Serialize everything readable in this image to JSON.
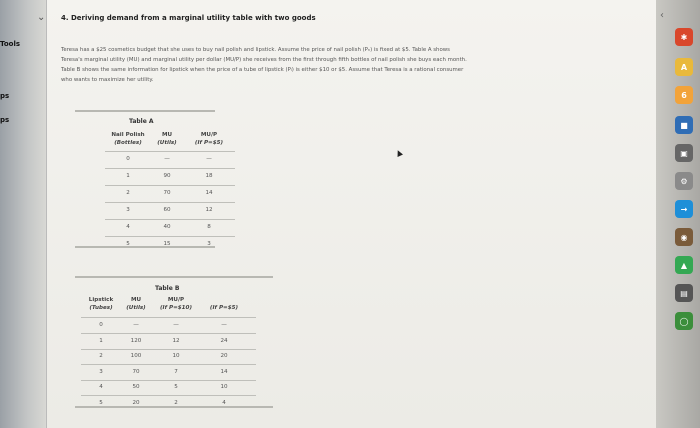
{
  "sidebar": {
    "tools_label": "Tools",
    "item1": "ps",
    "item2": "ps"
  },
  "question": {
    "title": "4. Deriving demand from a marginal utility table with two goods",
    "lines": [
      "Teresa has a $25 cosmetics budget that she uses to buy nail polish and lipstick. Assume the price of nail polish (Pₙ) is fixed at $5. Table A shows",
      "Teresa's marginal utility (MU) and marginal utility per dollar (MU/P) she receives from the first through fifth bottles of nail polish she buys each month.",
      "Table B shows the same information for lipstick when the price of a tube of lipstick (Pₗ) is either $10 or $5. Assume that Teresa is a rational consumer",
      "who wants to maximize her utility."
    ]
  },
  "table_a": {
    "title": "Table A",
    "col1_a": "Nail Polish",
    "col1_b": "(Bottles)",
    "col2_a": "MU",
    "col2_b": "(Utils)",
    "col3_a": "MU/P",
    "col3_b": "(If P=$5)",
    "rows": [
      [
        "0",
        "—",
        "—"
      ],
      [
        "1",
        "90",
        "18"
      ],
      [
        "2",
        "70",
        "14"
      ],
      [
        "3",
        "60",
        "12"
      ],
      [
        "4",
        "40",
        "8"
      ],
      [
        "5",
        "15",
        "3"
      ]
    ]
  },
  "table_b": {
    "title": "Table B",
    "col1_a": "Lipstick",
    "col1_b": "(Tubes)",
    "col2_a": "MU",
    "col2_b": "(Utils)",
    "col3_a": "MU/P",
    "col3_b": "(If P=$10)",
    "col4_b": "(If P=$5)",
    "rows": [
      [
        "0",
        "—",
        "—",
        "—"
      ],
      [
        "1",
        "120",
        "12",
        "24"
      ],
      [
        "2",
        "100",
        "10",
        "20"
      ],
      [
        "3",
        "70",
        "7",
        "14"
      ],
      [
        "4",
        "50",
        "5",
        "10"
      ],
      [
        "5",
        "20",
        "2",
        "4"
      ]
    ]
  },
  "dock": {
    "icons": [
      {
        "name": "app-icon-1",
        "color": "#d9472b",
        "glyph": "✱"
      },
      {
        "name": "app-icon-2",
        "color": "#e9b93b",
        "glyph": "A"
      },
      {
        "name": "app-icon-3",
        "color": "#f2a33a",
        "glyph": "6"
      },
      {
        "name": "app-icon-4",
        "color": "#2f6db5",
        "glyph": "■"
      },
      {
        "name": "app-icon-5",
        "color": "#666666",
        "glyph": "▣"
      },
      {
        "name": "app-icon-6",
        "color": "#8a8a8a",
        "glyph": "⚙"
      },
      {
        "name": "app-icon-7",
        "color": "#1e8fd8",
        "glyph": "→"
      },
      {
        "name": "app-icon-8",
        "color": "#7a5b3a",
        "glyph": "◉"
      },
      {
        "name": "app-icon-9",
        "color": "#34a853",
        "glyph": "▲"
      },
      {
        "name": "app-icon-10",
        "color": "#555555",
        "glyph": "▤"
      },
      {
        "name": "app-icon-11",
        "color": "#3b8e3b",
        "glyph": "◯"
      }
    ]
  }
}
